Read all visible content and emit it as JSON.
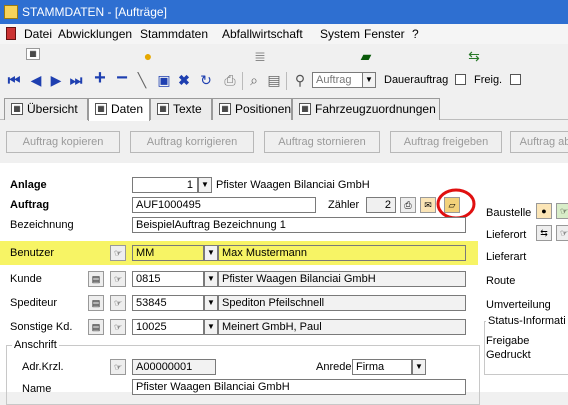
{
  "window": {
    "title": "STAMMDATEN - [Aufträge]"
  },
  "menu": [
    "Datei",
    "Abwicklungen",
    "Stammdaten",
    "Abfallwirtschaft",
    "System",
    "Fenster",
    "?"
  ],
  "toolbar": {
    "search_select": "Auftrag",
    "dauerauftrag_label": "Dauerauftrag",
    "freig_label": "Freig."
  },
  "tabs": [
    {
      "label": "Übersicht",
      "active": false
    },
    {
      "label": "Daten",
      "active": true
    },
    {
      "label": "Texte",
      "active": false
    },
    {
      "label": "Positionen",
      "active": false
    },
    {
      "label": "Fahrzeugzuordnungen",
      "active": false
    }
  ],
  "actions": [
    "Auftrag kopieren",
    "Auftrag korrigieren",
    "Auftrag stornieren",
    "Auftrag freigeben",
    "Auftrag ab"
  ],
  "form": {
    "anlage": {
      "label": "Anlage",
      "number": "1",
      "name": "Pfister Waagen Bilanciai GmbH"
    },
    "auftrag": {
      "label": "Auftrag",
      "value": "AUF1000495",
      "zaehler_label": "Zähler",
      "zaehler_value": "2"
    },
    "bezeichnung": {
      "label": "Bezeichnung",
      "value": "BeispielAuftrag Bezeichnung 1"
    },
    "benutzer": {
      "label": "Benutzer",
      "code": "MM",
      "name": "Max Mustermann"
    },
    "kunde": {
      "label": "Kunde",
      "code": "0815",
      "name": "Pfister Waagen Bilanciai GmbH"
    },
    "spediteur": {
      "label": "Spediteur",
      "code": "53845",
      "name": "Spediton Pfeilschnell"
    },
    "sonstige": {
      "label": "Sonstige Kd.",
      "code": "10025",
      "name": "Meinert GmbH, Paul"
    },
    "anschrift": {
      "group_label": "Anschrift",
      "adr_label": "Adr.Krzl.",
      "adr_value": "A00000001",
      "anrede_label": "Anrede",
      "anrede_value": "Firma",
      "name_label": "Name",
      "name_value": "Pfister Waagen Bilanciai GmbH"
    },
    "right": {
      "baustelle": "Baustelle",
      "lieferort": "Lieferort",
      "lieferart": "Lieferart",
      "route": "Route",
      "umverteilung": "Umverteilung",
      "status_group": "Status-Informati",
      "freigabe": "Freigabe",
      "gedruckt": "Gedruckt"
    }
  },
  "colors": {
    "titlebar": "#2e6fd1",
    "highlight": "#f6f24a",
    "annotation": "#e01010"
  }
}
